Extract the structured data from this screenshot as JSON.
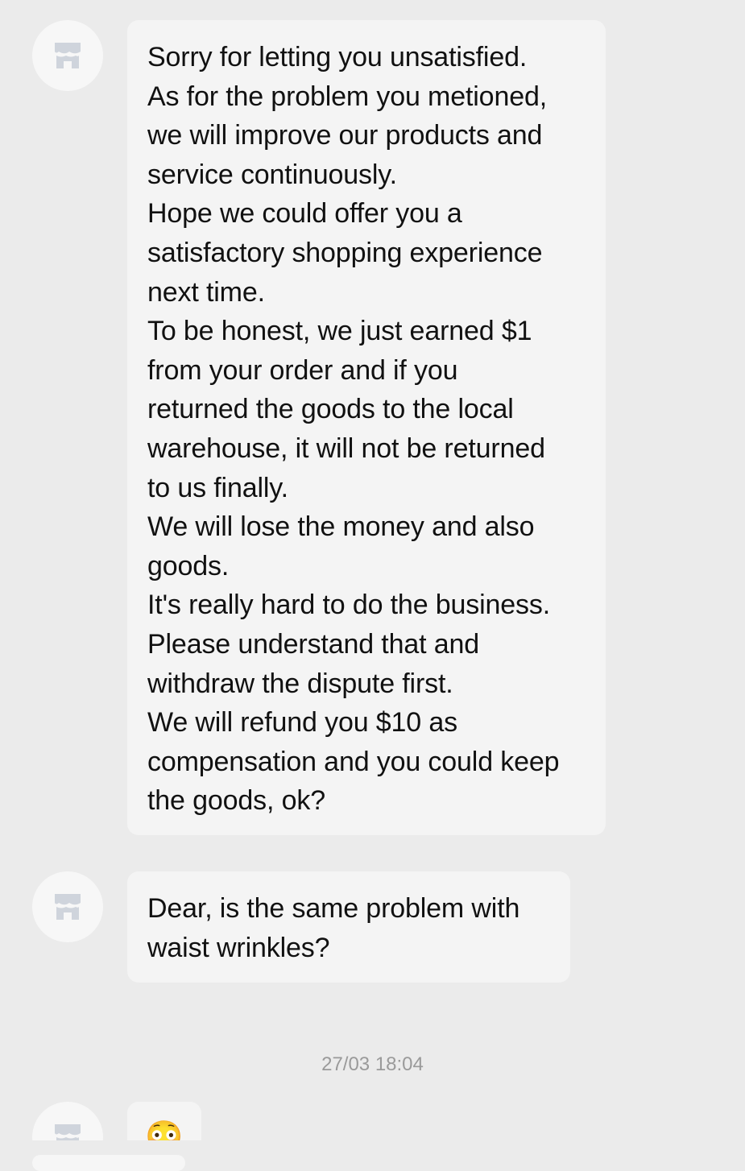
{
  "messages": [
    {
      "lines": [
        "Sorry for letting you unsatisfied.",
        "As for the problem you metioned,",
        "we will improve our products and",
        "service continuously.",
        "Hope we could offer you a",
        "satisfactory shopping experience",
        "next time.",
        "To be honest, we just earned $1",
        "from your order and if you",
        "returned the goods to the local",
        "warehouse, it will not be returned",
        "to us finally.",
        "We will lose the money and also",
        "goods.",
        "It's really hard to do the business.",
        "Please understand that and",
        "withdraw the dispute first.",
        "We will refund you $10 as",
        "compensation and you could keep",
        "the goods, ok?"
      ]
    },
    {
      "lines": [
        "Dear, is the same problem with",
        "waist wrinkles?"
      ]
    },
    {
      "emoji": "😳"
    }
  ],
  "timestamp": "27/03 18:04",
  "avatar": {
    "icon": "store-icon",
    "color": "#cfd4dc"
  },
  "colors": {
    "background": "#ebebeb",
    "bubble": "#f4f4f4",
    "text": "#111111",
    "timestamp": "#9a9a9a"
  }
}
